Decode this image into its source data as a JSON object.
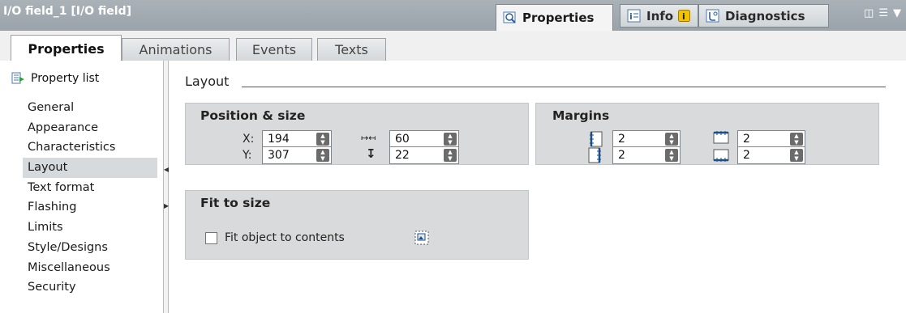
{
  "window": {
    "title": "I/O field_1 [I/O field]",
    "panel_tabs": [
      {
        "label": "Properties",
        "active": true
      },
      {
        "label": "Info",
        "active": false
      },
      {
        "label": "Diagnostics",
        "active": false
      }
    ]
  },
  "inspector_tabs": [
    {
      "label": "Properties",
      "active": true
    },
    {
      "label": "Animations",
      "active": false
    },
    {
      "label": "Events",
      "active": false
    },
    {
      "label": "Texts",
      "active": false
    }
  ],
  "sidebar": {
    "property_list_label": "Property list",
    "items": [
      {
        "label": "General"
      },
      {
        "label": "Appearance"
      },
      {
        "label": "Characteristics"
      },
      {
        "label": "Layout",
        "selected": true
      },
      {
        "label": "Text format"
      },
      {
        "label": "Flashing"
      },
      {
        "label": "Limits"
      },
      {
        "label": "Style/Designs"
      },
      {
        "label": "Miscellaneous"
      },
      {
        "label": "Security"
      }
    ]
  },
  "layout": {
    "section_title": "Layout",
    "position_size": {
      "title": "Position & size",
      "x_label": "X:",
      "x_value": "194",
      "y_label": "Y:",
      "y_value": "307",
      "width_value": "60",
      "height_value": "22"
    },
    "margins": {
      "title": "Margins",
      "left_value": "2",
      "right_value": "2",
      "top_value": "2",
      "bottom_value": "2"
    },
    "fit_to_size": {
      "title": "Fit to size",
      "checkbox_label": "Fit object to contents",
      "checked": false
    }
  },
  "colors": {
    "titlebar": "#9ea6ad",
    "group_bg": "#d9dadb",
    "selected_item": "#d6dadd",
    "info_badge": "#f3c300"
  }
}
